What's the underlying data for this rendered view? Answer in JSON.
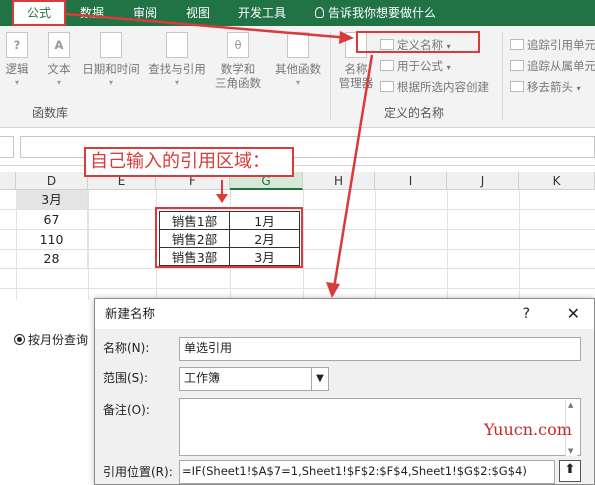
{
  "ribbon_tabs": [
    "公式",
    "数据",
    "审阅",
    "视图",
    "开发工具"
  ],
  "tell_me": "告诉我你想要做什么",
  "function_library": {
    "buttons": [
      {
        "label": "逻辑"
      },
      {
        "label": "文本"
      },
      {
        "label": "日期和时间"
      },
      {
        "label": "查找与引用"
      },
      {
        "label_line1": "数学和",
        "label_line2": "三角函数"
      },
      {
        "label": "其他函数"
      }
    ],
    "group_label": "函数库"
  },
  "defined_names": {
    "name_manager_line1": "名称",
    "name_manager_line2": "管理器",
    "define_name": "定义名称",
    "use_in_formula": "用于公式",
    "create_from_selection": "根据所选内容创建",
    "group_label": "定义的名称"
  },
  "formula_auditing": {
    "trace_precedents": "追踪引用单元",
    "trace_dependents": "追踪从属单元",
    "remove_arrows": "移去箭头"
  },
  "sheet": {
    "col_headers": [
      "D",
      "E",
      "F",
      "G",
      "H",
      "I",
      "J",
      "K"
    ],
    "col_d": [
      "3月",
      "67",
      "110",
      "28"
    ],
    "ref_rows": [
      [
        "销售1部",
        "1月"
      ],
      [
        "销售2部",
        "2月"
      ],
      [
        "销售3部",
        "3月"
      ]
    ],
    "annotation": "自己输入的引用区域：",
    "radio_label": "按月份查询"
  },
  "dialog": {
    "title": "新建名称",
    "help": "?",
    "close": "✕",
    "name_label": "名称(N):",
    "name_value": "单选引用",
    "scope_label": "范围(S):",
    "scope_value": "工作簿",
    "comment_label": "备注(O):",
    "refers_label": "引用位置(R):",
    "refers_value": "=IF(Sheet1!$A$7=1,Sheet1!$F$2:$F$4,Sheet1!$G$2:$G$4)"
  },
  "watermark": "Yuucn.com",
  "colors": {
    "excel_green": "#217346",
    "annotation_red": "#d93a3a"
  }
}
